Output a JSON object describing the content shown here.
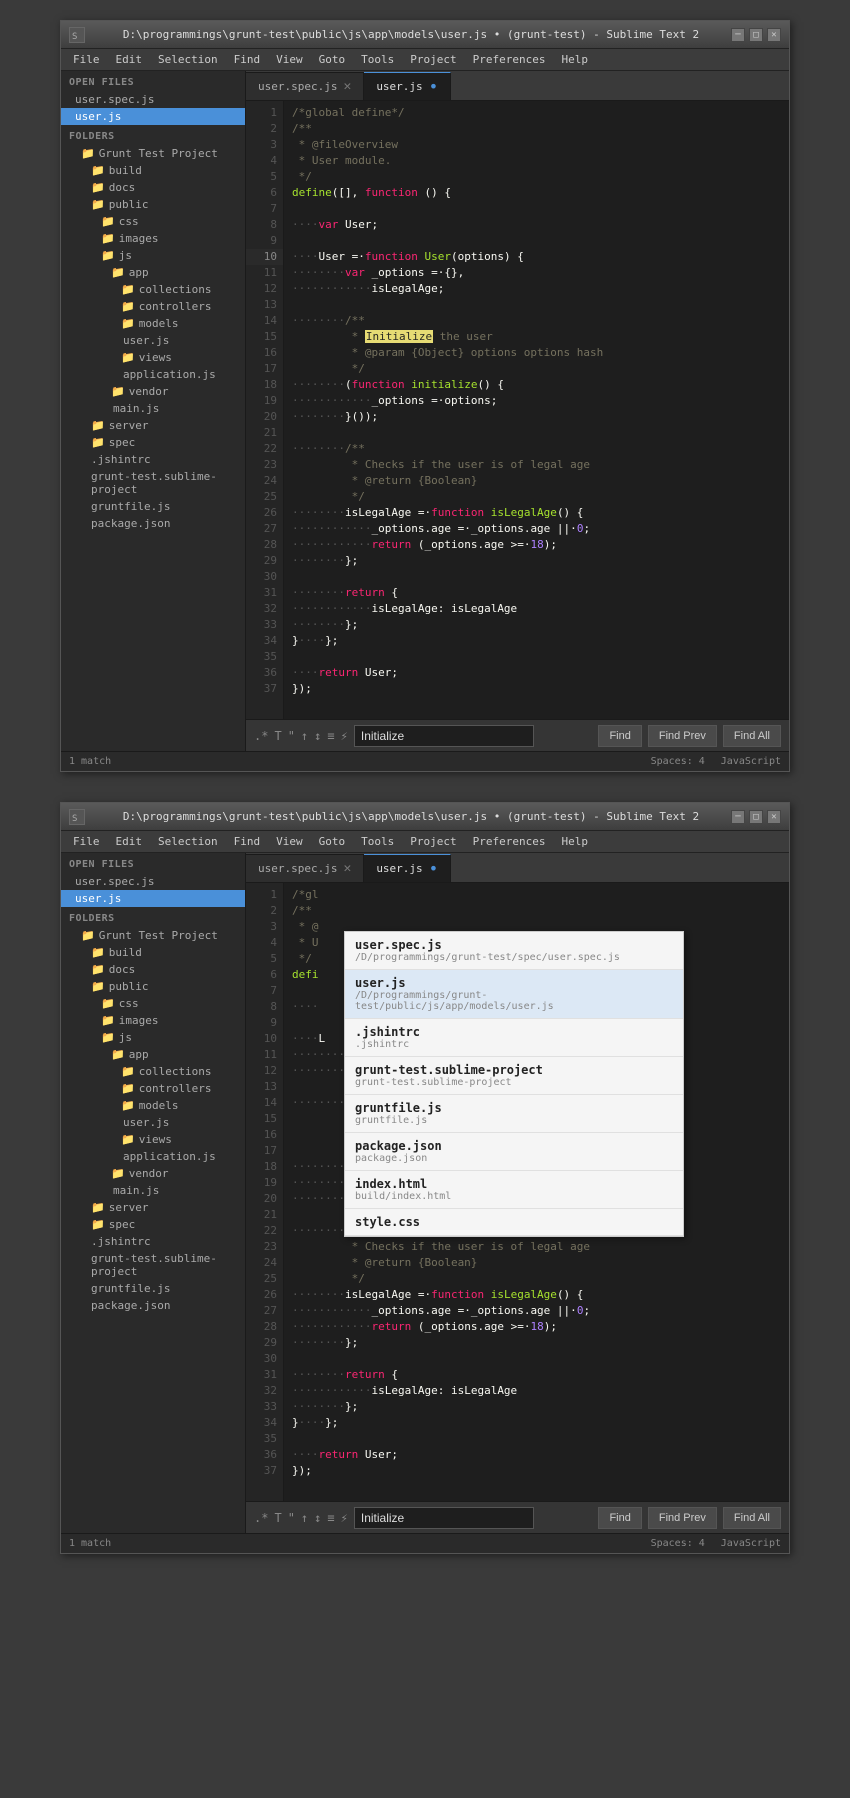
{
  "window1": {
    "title": "D:\\programmings\\grunt-test\\public\\js\\app\\models\\user.js • (grunt-test) - Sublime Text 2",
    "titlebar_icon": "ST",
    "controls": [
      "-",
      "□",
      "✕"
    ],
    "menubar": [
      "File",
      "Edit",
      "Selection",
      "Find",
      "View",
      "Goto",
      "Tools",
      "Project",
      "Preferences",
      "Help"
    ]
  },
  "sidebar": {
    "open_files_label": "OPEN FILES",
    "files": [
      {
        "name": "user.spec.js",
        "active": false
      },
      {
        "name": "user.js",
        "active": true
      }
    ],
    "folders_label": "FOLDERS",
    "tree": [
      {
        "name": "Grunt Test Project",
        "indent": 0,
        "type": "folder"
      },
      {
        "name": "build",
        "indent": 1,
        "type": "folder"
      },
      {
        "name": "docs",
        "indent": 1,
        "type": "folder"
      },
      {
        "name": "public",
        "indent": 1,
        "type": "folder"
      },
      {
        "name": "css",
        "indent": 2,
        "type": "folder"
      },
      {
        "name": "images",
        "indent": 2,
        "type": "folder"
      },
      {
        "name": "js",
        "indent": 2,
        "type": "folder"
      },
      {
        "name": "app",
        "indent": 3,
        "type": "folder"
      },
      {
        "name": "collections",
        "indent": 4,
        "type": "folder"
      },
      {
        "name": "controllers",
        "indent": 4,
        "type": "folder"
      },
      {
        "name": "models",
        "indent": 4,
        "type": "folder"
      },
      {
        "name": "user.js",
        "indent": 5,
        "type": "file"
      },
      {
        "name": "views",
        "indent": 4,
        "type": "folder"
      },
      {
        "name": "application.js",
        "indent": 5,
        "type": "file"
      },
      {
        "name": "vendor",
        "indent": 3,
        "type": "folder"
      },
      {
        "name": "main.js",
        "indent": 4,
        "type": "file"
      },
      {
        "name": "server",
        "indent": 1,
        "type": "folder"
      },
      {
        "name": "spec",
        "indent": 1,
        "type": "folder"
      },
      {
        "name": ".jshintrc",
        "indent": 1,
        "type": "file"
      },
      {
        "name": "grunt-test.sublime-project",
        "indent": 1,
        "type": "file"
      },
      {
        "name": "gruntfile.js",
        "indent": 1,
        "type": "file"
      },
      {
        "name": "package.json",
        "indent": 1,
        "type": "file"
      }
    ]
  },
  "tabs": [
    {
      "label": "user.spec.js",
      "active": false,
      "modified": false
    },
    {
      "label": "user.js",
      "active": true,
      "modified": true
    }
  ],
  "code": {
    "lines": [
      "/*global define*/",
      "/**",
      " * @fileOverview",
      " * User module.",
      " */",
      "define([], function () {",
      "",
      "····var User;",
      "",
      "····User = function User(options) {",
      "········var _options = {},",
      "············isLegalAge;",
      "",
      "········/**",
      "         * Initialize the user",
      "         * @param {Object} options options hash",
      "         */",
      "········(function initialize() {",
      "············_options = options;",
      "········}());",
      "",
      "········/**",
      "         * Checks if the user is of legal age",
      "         * @return {Boolean}",
      "         */",
      "········isLegalAge = function isLegalAge() {",
      "············_options.age = _options.age || 0;",
      "············return (_options.age >= 18);",
      "········};",
      "",
      "········return {",
      "············isLegalAge: isLegalAge",
      "········};",
      "····};",
      "",
      "····return User;",
      "});"
    ],
    "total_lines": 37
  },
  "findbar": {
    "search_value": "Initialize",
    "find_btn": "Find",
    "find_prev_btn": "Find Prev",
    "find_all_btn": "Find All"
  },
  "statusbar": {
    "match_text": "1 match",
    "spaces_text": "Spaces: 4",
    "language_text": "JavaScript"
  },
  "window2": {
    "title": "D:\\programmings\\grunt-test\\public\\js\\app\\models\\user.js • (grunt-test) - Sublime Text 2",
    "autocomplete": {
      "items": [
        {
          "primary": "user.spec.js",
          "secondary": "/D/programmings/grunt-test/spec/user.spec.js",
          "selected": false
        },
        {
          "primary": "user.js",
          "secondary": "/D/programmings/grunt-test/public/js/app/models/user.js",
          "selected": true
        },
        {
          "primary": ".jshintrc",
          "secondary": ".jshintrc",
          "selected": false
        },
        {
          "primary": "grunt-test.sublime-project",
          "secondary": "grunt-test.sublime-project",
          "selected": false
        },
        {
          "primary": "gruntfile.js",
          "secondary": "gruntfile.js",
          "selected": false
        },
        {
          "primary": "package.json",
          "secondary": "package.json",
          "selected": false
        },
        {
          "primary": "index.html",
          "secondary": "build/index.html",
          "selected": false
        },
        {
          "primary": "style.css",
          "secondary": "",
          "selected": false
        }
      ]
    }
  }
}
